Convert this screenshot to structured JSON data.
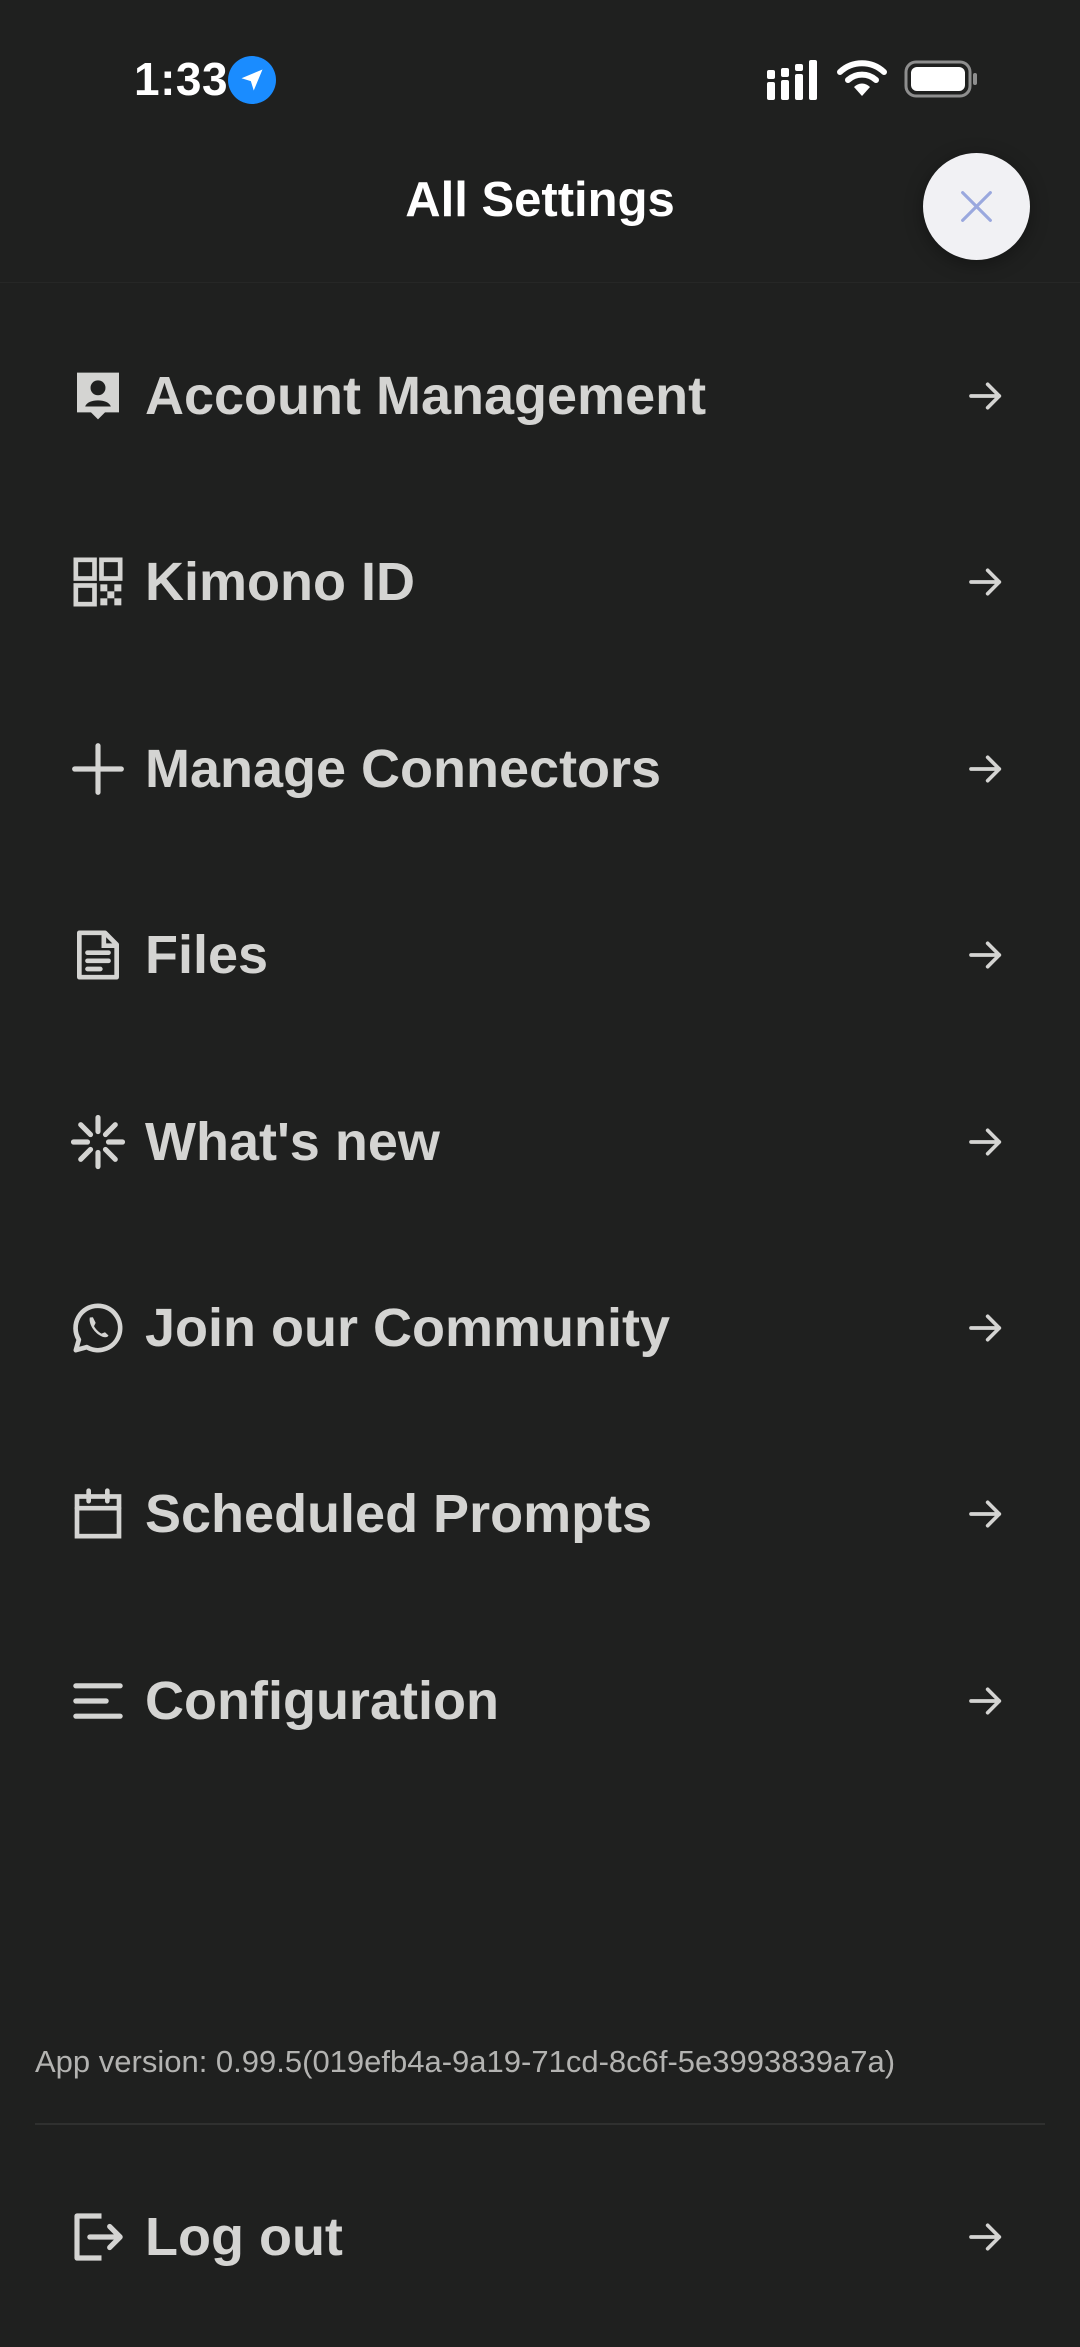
{
  "status_bar": {
    "time": "1:33",
    "location_icon": "location-arrow-icon",
    "signal_icon": "cellular-signal-icon",
    "wifi_icon": "wifi-icon",
    "battery_icon": "battery-full-icon"
  },
  "header": {
    "title": "All Settings",
    "close_icon": "close-icon"
  },
  "menu": {
    "items": [
      {
        "label": "Account Management",
        "icon": "account-badge-icon"
      },
      {
        "label": "Kimono ID",
        "icon": "qr-code-icon"
      },
      {
        "label": "Manage Connectors",
        "icon": "plus-icon"
      },
      {
        "label": "Files",
        "icon": "document-icon"
      },
      {
        "label": "What's new",
        "icon": "sparkle-icon"
      },
      {
        "label": "Join our Community",
        "icon": "whatsapp-icon"
      },
      {
        "label": "Scheduled Prompts",
        "icon": "calendar-icon"
      },
      {
        "label": "Configuration",
        "icon": "text-lines-icon"
      }
    ]
  },
  "footer": {
    "app_version": "App version: 0.99.5(019efb4a-9a19-71cd-8c6f-5e3993839a7a)",
    "logout_label": "Log out",
    "logout_icon": "logout-icon"
  },
  "colors": {
    "background": "#1f201f",
    "text": "#d4d4d2",
    "close_button_bg": "#f1f1f4",
    "close_icon": "#9aa8de",
    "location_badge": "#1a8cff"
  }
}
